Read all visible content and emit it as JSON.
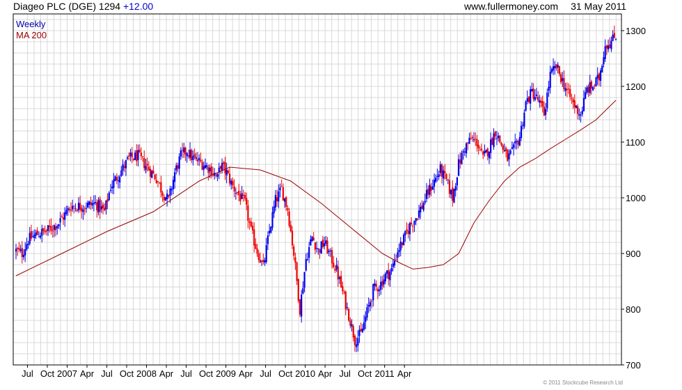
{
  "header": {
    "title": "Diageo PLC (DGE) 1294",
    "change": "+12.00",
    "site": "www.fullermoney.com",
    "date": "31 May 2011"
  },
  "footer": {
    "copyright": "© 2011 Stockcube Research Ltd"
  },
  "colors": {
    "up": "#0000ee",
    "down": "#ee0000",
    "ma": "#990000",
    "grid": "#d8d8d8",
    "frame": "#000000"
  },
  "chart_data": {
    "type": "candlestick",
    "title": "Diageo PLC (DGE) 1294",
    "frequency": "Weekly",
    "ylim": [
      700,
      1330
    ],
    "yticks": [
      700,
      800,
      900,
      1000,
      1100,
      1200,
      1300
    ],
    "xticks": [
      "Jul",
      "Oct",
      "2007",
      "Apr",
      "Jul",
      "Oct",
      "2008",
      "Apr",
      "Jul",
      "Oct",
      "2009",
      "Apr",
      "Jul",
      "Oct",
      "2010",
      "Apr",
      "Jul",
      "Oct",
      "2011",
      "Apr"
    ],
    "grid": true,
    "legend": {
      "position": "top-left",
      "entries": [
        "Weekly",
        "MA 200"
      ]
    },
    "series": [
      {
        "name": "Weekly",
        "close_path": [
          [
            0,
            905
          ],
          [
            4,
            900
          ],
          [
            8,
            925
          ],
          [
            14,
            935
          ],
          [
            20,
            940
          ],
          [
            28,
            955
          ],
          [
            36,
            985
          ],
          [
            44,
            985
          ],
          [
            52,
            990
          ],
          [
            58,
            975
          ],
          [
            62,
            1020
          ],
          [
            68,
            1045
          ],
          [
            74,
            1070
          ],
          [
            80,
            1075
          ],
          [
            86,
            1055
          ],
          [
            92,
            1035
          ],
          [
            96,
            1010
          ],
          [
            100,
            995
          ],
          [
            104,
            1045
          ],
          [
            108,
            1075
          ],
          [
            112,
            1085
          ],
          [
            116,
            1070
          ],
          [
            120,
            1065
          ],
          [
            124,
            1058
          ],
          [
            128,
            1050
          ],
          [
            132,
            1035
          ],
          [
            134,
            1060
          ],
          [
            138,
            1045
          ],
          [
            142,
            1020
          ],
          [
            146,
            1005
          ],
          [
            150,
            990
          ],
          [
            154,
            940
          ],
          [
            158,
            905
          ],
          [
            162,
            875
          ],
          [
            166,
            940
          ],
          [
            170,
            995
          ],
          [
            174,
            1015
          ],
          [
            178,
            980
          ],
          [
            182,
            900
          ],
          [
            186,
            800
          ],
          [
            190,
            890
          ],
          [
            194,
            930
          ],
          [
            198,
            905
          ],
          [
            202,
            920
          ],
          [
            206,
            895
          ],
          [
            210,
            870
          ],
          [
            214,
            830
          ],
          [
            218,
            790
          ],
          [
            222,
            745
          ],
          [
            226,
            755
          ],
          [
            230,
            795
          ],
          [
            234,
            835
          ],
          [
            238,
            842
          ],
          [
            242,
            860
          ],
          [
            246,
            870
          ],
          [
            250,
            905
          ],
          [
            254,
            925
          ],
          [
            258,
            950
          ],
          [
            262,
            965
          ],
          [
            266,
            985
          ],
          [
            270,
            1010
          ],
          [
            274,
            1030
          ],
          [
            278,
            1050
          ],
          [
            282,
            1030
          ],
          [
            286,
            1000
          ],
          [
            290,
            1060
          ],
          [
            294,
            1090
          ],
          [
            298,
            1105
          ],
          [
            302,
            1100
          ],
          [
            306,
            1070
          ],
          [
            310,
            1090
          ],
          [
            314,
            1120
          ],
          [
            318,
            1095
          ],
          [
            322,
            1070
          ],
          [
            326,
            1085
          ],
          [
            330,
            1110
          ],
          [
            334,
            1170
          ],
          [
            338,
            1190
          ],
          [
            342,
            1175
          ],
          [
            346,
            1150
          ],
          [
            350,
            1220
          ],
          [
            354,
            1235
          ],
          [
            358,
            1210
          ],
          [
            362,
            1185
          ],
          [
            366,
            1165
          ],
          [
            370,
            1150
          ],
          [
            374,
            1195
          ],
          [
            378,
            1200
          ],
          [
            382,
            1215
          ],
          [
            386,
            1275
          ],
          [
            390,
            1280
          ],
          [
            393,
            1292
          ]
        ]
      },
      {
        "name": "MA 200",
        "points": [
          [
            0,
            860
          ],
          [
            30,
            900
          ],
          [
            60,
            940
          ],
          [
            90,
            975
          ],
          [
            120,
            1030
          ],
          [
            140,
            1055
          ],
          [
            160,
            1050
          ],
          [
            180,
            1030
          ],
          [
            200,
            990
          ],
          [
            220,
            945
          ],
          [
            240,
            900
          ],
          [
            250,
            885
          ],
          [
            260,
            872
          ],
          [
            270,
            875
          ],
          [
            280,
            880
          ],
          [
            290,
            900
          ],
          [
            300,
            955
          ],
          [
            310,
            995
          ],
          [
            320,
            1030
          ],
          [
            330,
            1055
          ],
          [
            340,
            1070
          ],
          [
            350,
            1088
          ],
          [
            360,
            1105
          ],
          [
            370,
            1122
          ],
          [
            380,
            1140
          ],
          [
            393,
            1175
          ]
        ]
      }
    ]
  }
}
